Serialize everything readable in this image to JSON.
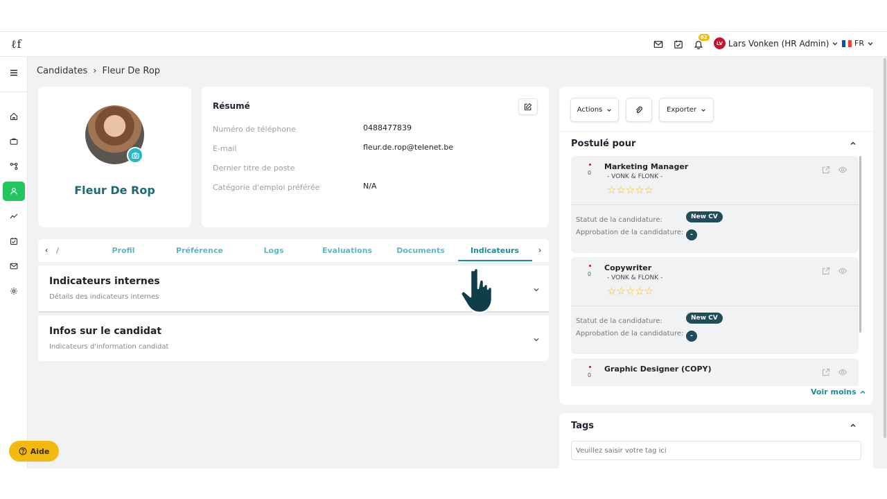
{
  "app": {
    "logo_text": "ℓf",
    "colors": {
      "accent": "#1c8c98",
      "active_nav": "#22c55e",
      "badge": "#f2b90f",
      "pill": "#1f4e5a"
    }
  },
  "header": {
    "icons": [
      "mail-icon",
      "task-check-icon",
      "bell-icon"
    ],
    "notification_count": "82",
    "user_initials": "LV",
    "user_name": "Lars Vonken (HR Admin)",
    "language": "FR"
  },
  "sidebar": {
    "items": [
      "menu-icon",
      "home-icon",
      "briefcase-icon",
      "workflow-icon",
      "candidates-icon",
      "analytics-icon",
      "tasks-icon",
      "mail-icon",
      "settings-icon"
    ],
    "active": "candidates-icon"
  },
  "breadcrumb": {
    "parent": "Candidates",
    "separator": "›",
    "current": "Fleur De Rop"
  },
  "profile": {
    "name": "Fleur De Rop"
  },
  "resume": {
    "title": "Résumé",
    "fields": [
      {
        "label": "Numéro de téléphone",
        "value": "0488477839"
      },
      {
        "label": "E-mail",
        "value": "fleur.de.rop@telenet.be"
      },
      {
        "label": "Dernier titre de poste",
        "value": ""
      },
      {
        "label": "Catégorie d'emploi préférée",
        "value": "N/A"
      }
    ]
  },
  "tabs": {
    "items": [
      "/",
      "Profil",
      "Préférence",
      "Logs",
      "Evaluations",
      "Documents",
      "Indicateurs"
    ],
    "active": "Indicateurs",
    "prev": "‹",
    "next": "›"
  },
  "accordions": [
    {
      "title": "Indicateurs internes",
      "subtitle": "Détails des indicateurs internes"
    },
    {
      "title": "Infos sur le candidat",
      "subtitle": "Indicateurs d'information candidat"
    }
  ],
  "actions": {
    "actions_label": "Actions",
    "export_label": "Exporter"
  },
  "applied": {
    "title": "Postulé pour",
    "status_label": "Statut de la candidature:",
    "approval_label": "Approbation de la candidature:",
    "items": [
      {
        "title": "Marketing Manager",
        "company": "- VONK & FLONK -",
        "count": "0",
        "stars": "☆☆☆☆☆",
        "status": "New CV",
        "approval": "-"
      },
      {
        "title": "Copywriter",
        "company": "- VONK & FLONK -",
        "count": "0",
        "stars": "☆☆☆☆☆",
        "status": "New CV",
        "approval": "-"
      },
      {
        "title": "Graphic Designer (COPY)",
        "company": "",
        "count": "0",
        "stars": "",
        "status": "",
        "approval": ""
      }
    ],
    "toggle_label": "Voir moins"
  },
  "tags": {
    "title": "Tags",
    "placeholder": "Veuillez saisir votre tag ici"
  },
  "help": {
    "label": "Aide"
  }
}
